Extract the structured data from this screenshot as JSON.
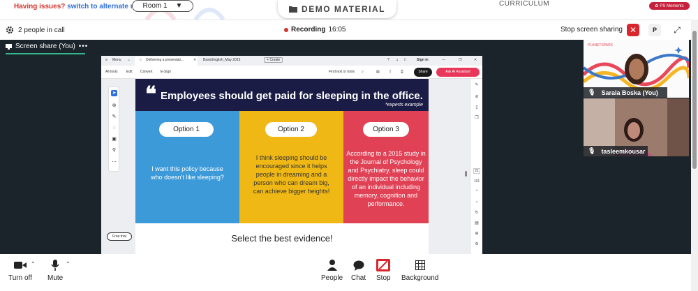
{
  "top": {
    "issues_text": "Having issues?",
    "switch_link": "switch to alternate room",
    "room_value": "Room 1",
    "demo_title": "DEMO MATERIAL",
    "curriculum_tab": "CURRICULUM",
    "ps_moments": "PS Moments"
  },
  "call": {
    "people_count": "2 people in call",
    "recording_label": "Recording",
    "recording_time": "16:05",
    "stop_sharing": "Stop screen sharing",
    "stop_x": "✕",
    "profile_initial": "P"
  },
  "share": {
    "label": "Screen share (You)",
    "more": "•••"
  },
  "browser": {
    "menu": "Menu",
    "tab1": "Delivering a presentati...",
    "tab2": "BasicEnglish_May 2023",
    "new_tab": "Create",
    "sign_in": "Sign in",
    "tb_all_tools": "All tools",
    "tb_edit": "Edit",
    "tb_convert": "Convert",
    "tb_esign": "E-Sign",
    "find_text": "Find text or tools",
    "share_btn": "Share",
    "ai_btn": "Ask AI Assistant",
    "free_trial": "Free trial",
    "page_num": "21",
    "page_total": "101"
  },
  "slide": {
    "quote": "❝",
    "title": "Employees should get paid for sleeping in the office.",
    "subtitle": "*experts example",
    "options": [
      {
        "label": "Option 1",
        "text": "I want this policy because who doesn't like sleeping?"
      },
      {
        "label": "Option 2",
        "text": "I think sleeping should be encouraged since it helps people in dreaming and a person who can dream big, can achieve bigger heights!"
      },
      {
        "label": "Option 3",
        "text": "According to a 2015 study in the Journal of Psychology and Psychiatry, sleep could directly impact the behavior of an individual including memory, cognition and performance."
      }
    ],
    "footer": "Select the best evidence!"
  },
  "participants": [
    {
      "name": "Sarala Boska (You)"
    },
    {
      "name": "tasleemkousar"
    }
  ],
  "controls": {
    "turn_off": "Turn off",
    "mute": "Mute",
    "people": "People",
    "chat": "Chat",
    "stop": "Stop",
    "background": "Background"
  },
  "colors": {
    "accent_red": "#d9262c",
    "share_green": "#33b68a",
    "slide_navy": "#1a1c45",
    "option1_blue": "#3d9ad9",
    "option2_yellow": "#f0b814",
    "option3_red": "#e04155",
    "stage_dark": "#1b242b"
  }
}
